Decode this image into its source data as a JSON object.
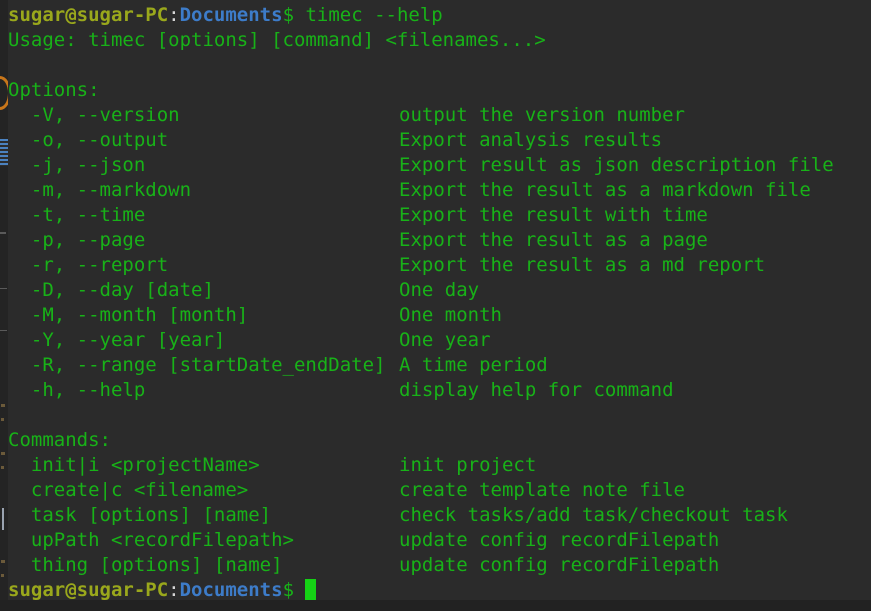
{
  "terminal": {
    "prompt": {
      "user_host": "sugar@sugar-PC",
      "separator": ":",
      "cwd": "Documents",
      "symbol": "$"
    },
    "typed_command": " timec --help",
    "usage_line": "Usage: timec [options] [command] <filenames...>",
    "options_heading": "Options:",
    "commands_heading": "Commands:",
    "options": [
      {
        "flag": "  -V, --version",
        "description": "output the version number"
      },
      {
        "flag": "  -o, --output",
        "description": "Export analysis results"
      },
      {
        "flag": "  -j, --json",
        "description": "Export result as json description file"
      },
      {
        "flag": "  -m, --markdown",
        "description": "Export the result as a markdown file"
      },
      {
        "flag": "  -t, --time",
        "description": "Export the result with time"
      },
      {
        "flag": "  -p, --page",
        "description": "Export the result as a page"
      },
      {
        "flag": "  -r, --report",
        "description": "Export the result as a md report"
      },
      {
        "flag": "  -D, --day [date]",
        "description": "One day"
      },
      {
        "flag": "  -M, --month [month]",
        "description": "One month"
      },
      {
        "flag": "  -Y, --year [year]",
        "description": "One year"
      },
      {
        "flag": "  -R, --range [startDate_endDate]",
        "description": "A time period"
      },
      {
        "flag": "  -h, --help",
        "description": "display help for command"
      }
    ],
    "commands": [
      {
        "name": "  init|i <projectName>",
        "description": "init project"
      },
      {
        "name": "  create|c <filename>",
        "description": "create template note file"
      },
      {
        "name": "  task [options] [name]",
        "description": "check tasks/add task/checkout task"
      },
      {
        "name": "  upPath <recordFilepath>",
        "description": "update config recordFilepath"
      },
      {
        "name": "  thing [options] [name]",
        "description": "update config recordFilepath"
      }
    ],
    "colors": {
      "background": "#2b2b2b",
      "output_green": "#18b218",
      "user_host_olive": "#9aa81c",
      "cwd_blue": "#3d7cc9",
      "cursor_green": "#15d215"
    }
  }
}
